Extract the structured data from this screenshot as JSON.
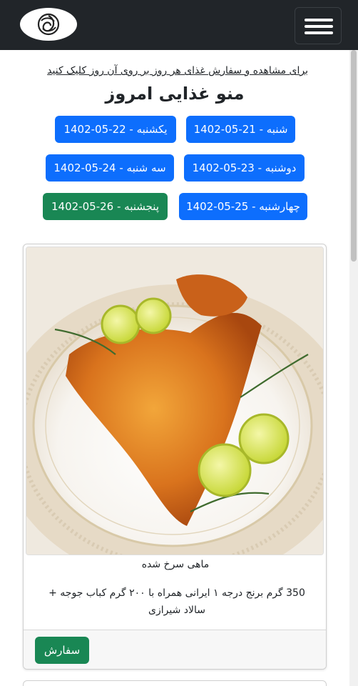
{
  "navbar": {
    "logo_icon": "spiral-logo-icon",
    "menu_icon": "hamburger-menu-icon",
    "background": "#212529"
  },
  "instruction": {
    "text": "برای مشاهده و سفارش غذای هر روز بر روی آن روز کلیک کنید"
  },
  "page_title": "منو غذایی امروز",
  "days": [
    {
      "label": "شنبه - 21-05-1402",
      "active": false
    },
    {
      "label": "یکشنبه - 22-05-1402",
      "active": false
    },
    {
      "label": "دوشنبه - 23-05-1402",
      "active": false
    },
    {
      "label": "سه شنبه - 24-05-1402",
      "active": false
    },
    {
      "label": "چهارشنبه - 25-05-1402",
      "active": false
    },
    {
      "label": "پنجشنبه - 26-05-1402",
      "active": true
    }
  ],
  "colors": {
    "primary": "#0d6efd",
    "success": "#198754"
  },
  "menu_item": {
    "name": "ماهی سرخ شده",
    "description": "350 گرم برنج درجه ۱ ایرانی همراه با ۲۰۰ گرم کباب جوجه + سالاد شیرازی",
    "order_label": "سفارش"
  }
}
